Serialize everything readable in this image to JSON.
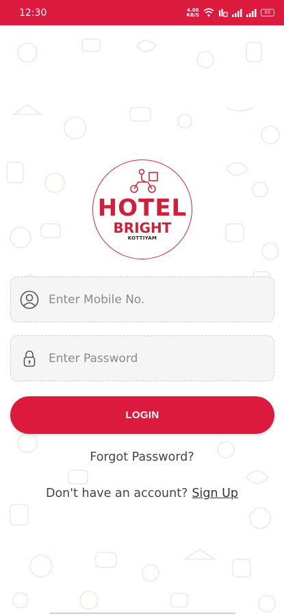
{
  "status_bar": {
    "time": "12:30",
    "net_speed_value": "4.00",
    "net_speed_unit": "KB/S",
    "battery_level": "65",
    "icons": [
      "wifi-icon",
      "volte-icon",
      "signal-icon",
      "signal-icon",
      "battery-icon"
    ]
  },
  "logo": {
    "line1": "HOTEL",
    "line2": "BRIGHT",
    "line3": "KOTTIYAM",
    "icon": "delivery-scooter-icon"
  },
  "form": {
    "mobile_placeholder": "Enter Mobile No.",
    "mobile_value": "",
    "mobile_icon": "user-icon",
    "password_placeholder": "Enter Password",
    "password_value": "",
    "password_icon": "lock-icon"
  },
  "actions": {
    "login_label": "LOGIN",
    "forgot_label": "Forgot Password?",
    "signup_prompt": "Don't have an account?",
    "signup_label": "Sign Up"
  },
  "colors": {
    "brand": "#dc1a3d",
    "field_bg": "#f4f4f4",
    "text": "#444444"
  }
}
